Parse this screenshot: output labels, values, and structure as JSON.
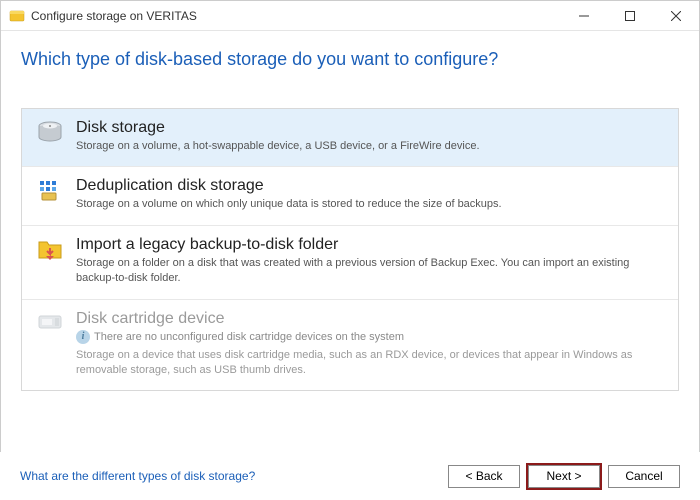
{
  "window": {
    "title": "Configure storage on VERITAS"
  },
  "question": "Which type of disk-based storage do you want to configure?",
  "options": [
    {
      "title": "Disk storage",
      "desc": "Storage on a volume, a hot-swappable device, a USB device, or a FireWire device."
    },
    {
      "title": "Deduplication disk storage",
      "desc": "Storage on a volume on which only unique data is stored to reduce the size of backups."
    },
    {
      "title": "Import a legacy backup-to-disk folder",
      "desc": "Storage on a folder on a disk that was created with a previous version of Backup Exec.  You can import an existing backup-to-disk folder."
    },
    {
      "title": "Disk cartridge device",
      "info": "There are no unconfigured disk cartridge devices on the system",
      "desc": "Storage on a device that uses disk cartridge media, such as an RDX device, or devices that appear in Windows as removable storage, such as USB thumb drives."
    }
  ],
  "footer": {
    "help": "What are the different types of disk storage?",
    "back": "< Back",
    "next": "Next >",
    "cancel": "Cancel"
  }
}
